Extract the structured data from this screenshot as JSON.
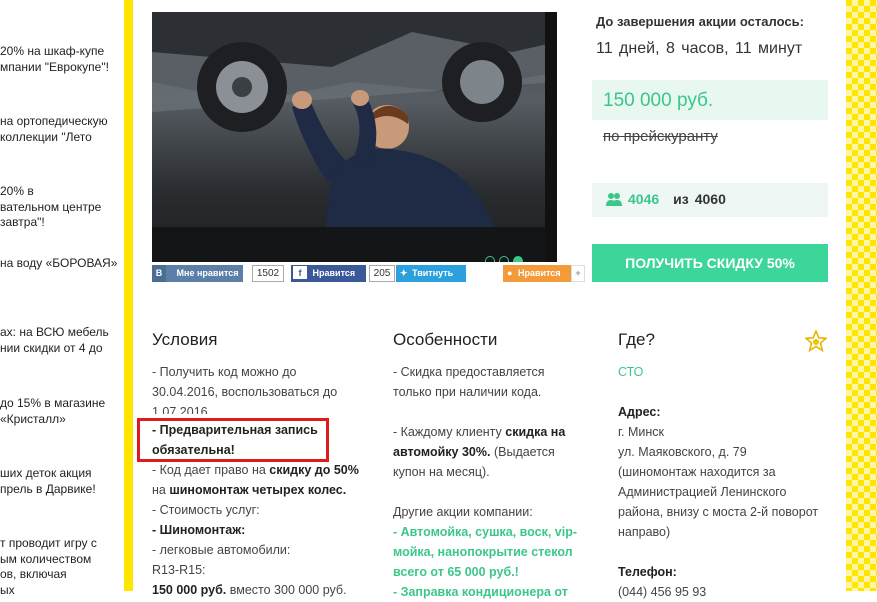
{
  "teasers": [
    {
      "lines": [
        "20% на шкаф-купе",
        "мпании \"Еврокупе\"!"
      ]
    },
    {
      "lines": [
        "на ортопедическую",
        "коллекции \"Лето"
      ]
    },
    {
      "lines": [
        "20% в",
        "вательном центре",
        "завтра\"!"
      ]
    },
    {
      "lines": [
        "на воду «БОРОВАЯ»!"
      ]
    },
    {
      "lines": [
        "ах: на ВСЮ мебель",
        "нии скидки от 4 до"
      ]
    },
    {
      "lines": [
        "до 15% в магазине",
        "«Кристалл»"
      ]
    },
    {
      "lines": [
        "ших деток акция",
        "прель в Дарвике!"
      ]
    },
    {
      "lines": [
        "т проводит игру с",
        "ым количеством",
        "ов, включая",
        "ых"
      ]
    }
  ],
  "social": {
    "vk_label": "Мне нравится",
    "vk_count": "1502",
    "fb_label": "Нравится",
    "fb_count": "205",
    "tw_label": "Твитнуть",
    "ok_label": "Нравится",
    "ok_plus": "+"
  },
  "offer": {
    "countdown_label": "До завершения акции осталось:",
    "countdown_value": "11 дней,  8 часов,  11 минут",
    "price": "150 000 руб.",
    "old_price": "по прейскуранту",
    "count_current": "4046",
    "count_sep": "из",
    "count_total": "4060",
    "cta_label": "ПОЛУЧИТЬ СКИДКУ 50%"
  },
  "conditions": {
    "title": "Условия",
    "l1": "- Получить код можно до",
    "l2": "30.04.2016, воспользоваться до",
    "l3": "1.07.2016",
    "l4": "- Предварительная запись",
    "l5": "обязательна!",
    "l6a": "- Код дает право на ",
    "l6b": "скидку до 50%",
    "l7a": "на ",
    "l7b": "шиномонтаж четырех колес.",
    "l8": "- Стоимость услуг:",
    "l9": "- Шиномонтаж:",
    "l10": "- легковые автомобили:",
    "l11": "R13-R15:",
    "l12a": "150 000 руб.",
    "l12b": " вместо 300 000 руб."
  },
  "features": {
    "title": "Особенности",
    "l1": "- Скидка предоставляется",
    "l2": "только при наличии кода.",
    "l3a": "- Каждому клиенту ",
    "l3b": "скидка на",
    "l4a": "автомойку 30%.",
    "l4b": " (Выдается",
    "l5": "купон на месяц).",
    "l6": "Другие акции компании:",
    "l7": "- Автомойка, сушка, воск, vip-",
    "l8": "мойка, нанопокрытие стекол",
    "l9": "всего от 65 000 руб.!",
    "l10": "- Заправка кондиционера от"
  },
  "where": {
    "title": "Где?",
    "company": "СТО",
    "address_label": "Адрес:",
    "a1": "г. Минск",
    "a2": "ул. Маяковского, д. 79",
    "a3": "(шиномонтаж находится за",
    "a4": "Администрацией Ленинского",
    "a5": "района, внизу с моста 2-й поворот",
    "a6": "направо)",
    "phone_label": "Телефон:",
    "phone": "(044) 456 95 93"
  }
}
